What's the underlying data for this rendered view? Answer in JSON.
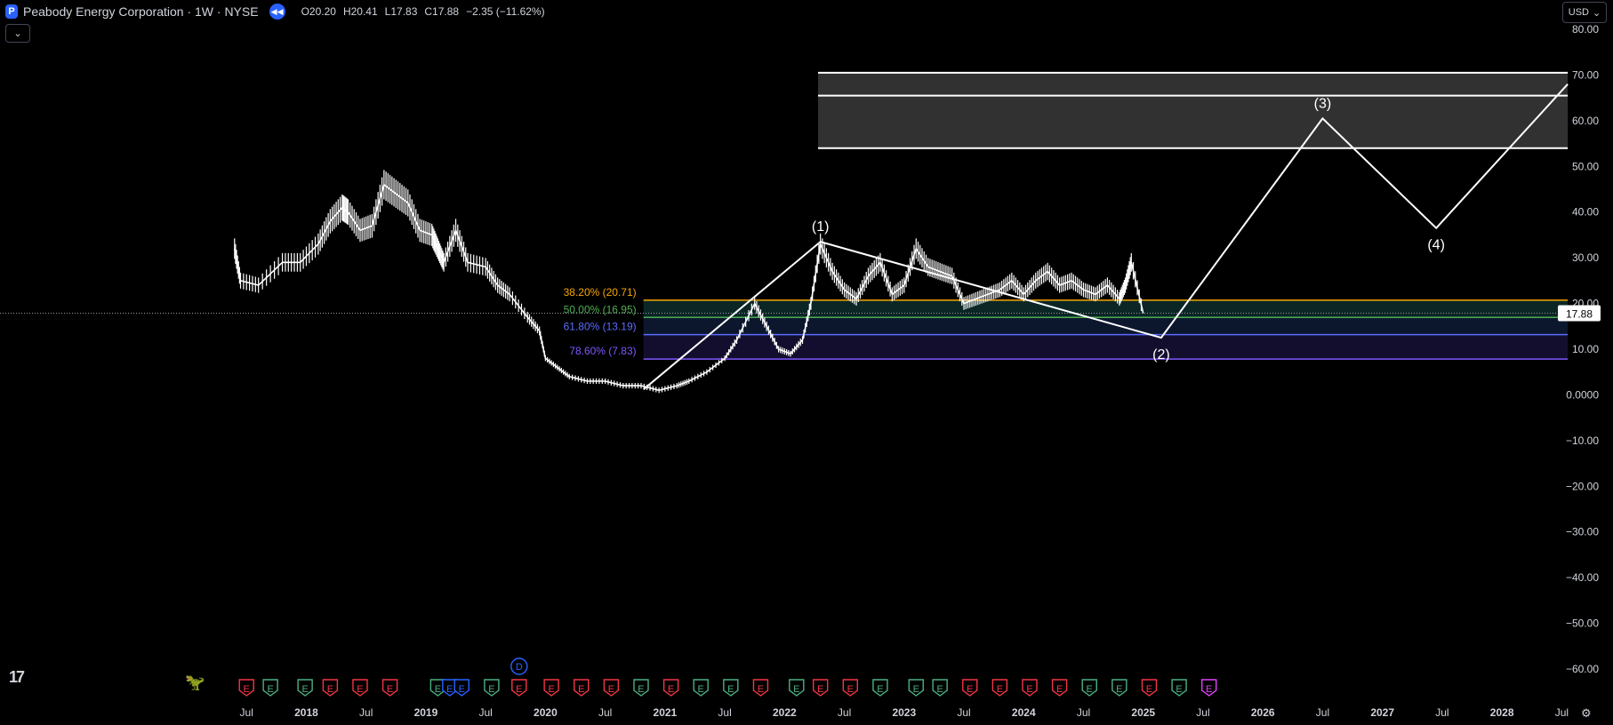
{
  "header": {
    "logo_letter": "P",
    "title": "Peabody Energy Corporation · 1W · NYSE",
    "ohlc": [
      {
        "key": "O",
        "value": "20.20"
      },
      {
        "key": "H",
        "value": "20.41"
      },
      {
        "key": "L",
        "value": "17.83"
      },
      {
        "key": "C",
        "value": "17.88"
      }
    ],
    "change": "−2.35 (−11.62%)"
  },
  "currency": "USD",
  "colors": {
    "background": "#000000",
    "price_line": "#ffffff",
    "fib_382": "#f7a600",
    "fib_500": "#4caf50",
    "fib_618": "#5a6cff",
    "fib_786": "#7e57ff",
    "earnings_red": "#f23645",
    "earnings_green": "#4caf82",
    "earnings_purple": "#e040fb",
    "dividend_blue": "#2962ff"
  },
  "chart_data": {
    "type": "line",
    "x_axis_ticks": [
      "Jul",
      "2018",
      "Jul",
      "2019",
      "Jul",
      "2020",
      "Jul",
      "2021",
      "Jul",
      "2022",
      "Jul",
      "2023",
      "Jul",
      "2024",
      "Jul",
      "2025",
      "Jul",
      "2026",
      "Jul",
      "2027",
      "Jul",
      "2028",
      "Jul"
    ],
    "y_axis_ticks": [
      "80.00",
      "70.00",
      "60.00",
      "50.00",
      "40.00",
      "30.00",
      "20.00",
      "10.00",
      "0.0000",
      "−10.00",
      "−20.00",
      "−30.00",
      "−40.00",
      "−50.00",
      "−60.00"
    ],
    "ylim": [
      -60,
      80
    ],
    "last_price_label": "17.88",
    "last_price": 17.88,
    "price_series": {
      "x": [
        2017.4,
        2017.45,
        2017.6,
        2017.8,
        2017.95,
        2018.1,
        2018.2,
        2018.3,
        2018.35,
        2018.45,
        2018.55,
        2018.65,
        2018.75,
        2018.85,
        2018.95,
        2019.05,
        2019.1,
        2019.15,
        2019.25,
        2019.35,
        2019.5,
        2019.6,
        2019.7,
        2019.85,
        2019.95,
        2020.0,
        2020.1,
        2020.2,
        2020.35,
        2020.5,
        2020.65,
        2020.8,
        2020.95,
        2021.1,
        2021.2,
        2021.35,
        2021.5,
        2021.6,
        2021.75,
        2021.85,
        2021.95,
        2022.05,
        2022.15,
        2022.22,
        2022.3,
        2022.4,
        2022.5,
        2022.6,
        2022.7,
        2022.8,
        2022.9,
        2023.0,
        2023.1,
        2023.2,
        2023.3,
        2023.4,
        2023.5,
        2023.6,
        2023.7,
        2023.8,
        2023.9,
        2024.0,
        2024.1,
        2024.2,
        2024.3,
        2024.4,
        2024.5,
        2024.6,
        2024.7,
        2024.8,
        2024.85,
        2024.9,
        2025.0
      ],
      "y": [
        32,
        25,
        24,
        29,
        29,
        33,
        38,
        41,
        40,
        36,
        37,
        46,
        44,
        42,
        36,
        35,
        32,
        29,
        36,
        29,
        28,
        24,
        22,
        17,
        14,
        8,
        6,
        4,
        3,
        3,
        2,
        2,
        1,
        2,
        3,
        5,
        8,
        12,
        20,
        15,
        10,
        9,
        12,
        20,
        33,
        27,
        23,
        21,
        26,
        29,
        22,
        24,
        32,
        28,
        27,
        26,
        20,
        21,
        22,
        23,
        25,
        22,
        25,
        27,
        24,
        25,
        23,
        22,
        24,
        21,
        24,
        29,
        17.88
      ]
    },
    "fibonacci": [
      {
        "label": "38.20% (20.71)",
        "level": 20.71,
        "color": "#f7a600"
      },
      {
        "label": "50.00% (16.95)",
        "level": 16.95,
        "color": "#4caf50"
      },
      {
        "label": "61.80% (13.19)",
        "level": 13.19,
        "color": "#5a6cff"
      },
      {
        "label": "78.60% (7.83)",
        "level": 7.83,
        "color": "#7e57ff"
      }
    ],
    "fib_start_x": 2020.82,
    "fib_end_x": 2028.55,
    "waves": [
      {
        "label": "",
        "x": 2020.82,
        "y": 1.2
      },
      {
        "label": "(1)",
        "x": 2022.3,
        "y": 33.5
      },
      {
        "label": "(2)",
        "x": 2025.15,
        "y": 12.5
      },
      {
        "label": "(3)",
        "x": 2026.5,
        "y": 60.5
      },
      {
        "label": "(4)",
        "x": 2027.45,
        "y": 36.5
      },
      {
        "label": "",
        "x": 2028.55,
        "y": 68
      }
    ],
    "target_zone": {
      "x_start": 2022.28,
      "x_end": 2028.55,
      "top": 70.5,
      "mid": 65.5,
      "bottom": 54
    }
  },
  "events": [
    {
      "type": "E",
      "x": 2017.5,
      "color": "red"
    },
    {
      "type": "E",
      "x": 2017.7,
      "color": "green"
    },
    {
      "type": "E",
      "x": 2017.99,
      "color": "green"
    },
    {
      "type": "E",
      "x": 2018.2,
      "color": "red"
    },
    {
      "type": "E",
      "x": 2018.45,
      "color": "red"
    },
    {
      "type": "E",
      "x": 2018.7,
      "color": "red"
    },
    {
      "type": "E",
      "x": 2019.1,
      "color": "green"
    },
    {
      "type": "E",
      "x": 2019.2,
      "color": "blue"
    },
    {
      "type": "E",
      "x": 2019.3,
      "color": "blue"
    },
    {
      "type": "E",
      "x": 2019.55,
      "color": "green"
    },
    {
      "type": "E",
      "x": 2019.78,
      "color": "red"
    },
    {
      "type": "E",
      "x": 2020.05,
      "color": "red"
    },
    {
      "type": "E",
      "x": 2020.3,
      "color": "red"
    },
    {
      "type": "E",
      "x": 2020.55,
      "color": "red"
    },
    {
      "type": "E",
      "x": 2020.8,
      "color": "green"
    },
    {
      "type": "E",
      "x": 2021.05,
      "color": "red"
    },
    {
      "type": "E",
      "x": 2021.3,
      "color": "green"
    },
    {
      "type": "E",
      "x": 2021.55,
      "color": "green"
    },
    {
      "type": "E",
      "x": 2021.8,
      "color": "red"
    },
    {
      "type": "E",
      "x": 2022.1,
      "color": "green"
    },
    {
      "type": "E",
      "x": 2022.3,
      "color": "red"
    },
    {
      "type": "E",
      "x": 2022.55,
      "color": "red"
    },
    {
      "type": "E",
      "x": 2022.8,
      "color": "green"
    },
    {
      "type": "E",
      "x": 2023.1,
      "color": "green"
    },
    {
      "type": "E",
      "x": 2023.3,
      "color": "green"
    },
    {
      "type": "E",
      "x": 2023.55,
      "color": "red"
    },
    {
      "type": "E",
      "x": 2023.8,
      "color": "red"
    },
    {
      "type": "E",
      "x": 2024.05,
      "color": "red"
    },
    {
      "type": "E",
      "x": 2024.3,
      "color": "red"
    },
    {
      "type": "E",
      "x": 2024.55,
      "color": "green"
    },
    {
      "type": "E",
      "x": 2024.8,
      "color": "green"
    },
    {
      "type": "E",
      "x": 2025.05,
      "color": "red"
    },
    {
      "type": "E",
      "x": 2025.3,
      "color": "green"
    },
    {
      "type": "E",
      "x": 2025.55,
      "color": "purple"
    }
  ],
  "dividend_marker": {
    "label": "D",
    "x": 2019.78
  }
}
